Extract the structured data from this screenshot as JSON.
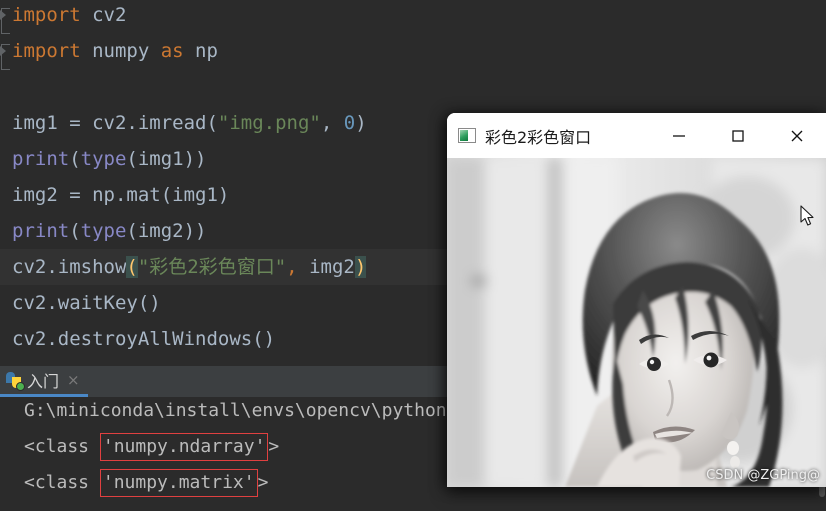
{
  "editor": {
    "lines": [
      {
        "id": "l1",
        "parts": [
          {
            "t": "import",
            "c": "kw"
          },
          {
            "t": " cv2",
            "c": "pl"
          }
        ],
        "fold": true,
        "current": false
      },
      {
        "id": "l2",
        "parts": [
          {
            "t": "import",
            "c": "kw"
          },
          {
            "t": " numpy ",
            "c": "pl"
          },
          {
            "t": "as",
            "c": "kw"
          },
          {
            "t": " np",
            "c": "pl"
          }
        ],
        "fold": true,
        "current": false
      },
      {
        "id": "l3",
        "parts": [],
        "fold": false,
        "current": false
      },
      {
        "id": "l4",
        "parts": [
          {
            "t": "img1 = cv2.imread(",
            "c": "pl"
          },
          {
            "t": "\"img.png\"",
            "c": "str"
          },
          {
            "t": ", ",
            "c": "pl"
          },
          {
            "t": "0",
            "c": "num"
          },
          {
            "t": ")",
            "c": "pl"
          }
        ],
        "fold": false,
        "current": false
      },
      {
        "id": "l5",
        "parts": [
          {
            "t": "print",
            "c": "bi"
          },
          {
            "t": "(",
            "c": "pl"
          },
          {
            "t": "type",
            "c": "bi"
          },
          {
            "t": "(img1))",
            "c": "pl"
          }
        ],
        "fold": false,
        "current": false
      },
      {
        "id": "l6",
        "parts": [
          {
            "t": "img2 = np.mat(img1)",
            "c": "pl"
          }
        ],
        "fold": false,
        "current": false
      },
      {
        "id": "l7",
        "parts": [
          {
            "t": "print",
            "c": "bi"
          },
          {
            "t": "(",
            "c": "pl"
          },
          {
            "t": "type",
            "c": "bi"
          },
          {
            "t": "(img2))",
            "c": "pl"
          }
        ],
        "fold": false,
        "current": false
      },
      {
        "id": "l8",
        "parts": [
          {
            "t": "cv2.imshow",
            "c": "pl"
          },
          {
            "t": "(",
            "c": "brace-hl"
          },
          {
            "t": "\"彩色2彩色窗口\"",
            "c": "str"
          },
          {
            "t": ",",
            "c": "kw"
          },
          {
            "t": " img2",
            "c": "pl"
          },
          {
            "t": ")",
            "c": "brace-hl"
          }
        ],
        "fold": false,
        "current": true
      },
      {
        "id": "l9",
        "parts": [
          {
            "t": "cv2.waitKey()",
            "c": "pl"
          }
        ],
        "fold": false,
        "current": false
      },
      {
        "id": "l10",
        "parts": [
          {
            "t": "cv2.destroyAllWindows()",
            "c": "pl"
          }
        ],
        "fold": false,
        "current": false
      }
    ]
  },
  "console": {
    "tab": {
      "label": "入门",
      "close_label": "×",
      "icon": "python-icon"
    },
    "lines": [
      {
        "id": "c1",
        "segments": [
          {
            "t": "G:\\miniconda\\install\\envs\\opencv\\python.exe",
            "box": false
          }
        ]
      },
      {
        "id": "c2",
        "segments": [
          {
            "t": "<class ",
            "box": false
          },
          {
            "t": "'numpy.ndarray'",
            "box": true
          },
          {
            "t": ">",
            "box": false
          }
        ]
      },
      {
        "id": "c3",
        "segments": [
          {
            "t": "<class ",
            "box": false
          },
          {
            "t": "'numpy.matrix'",
            "box": true
          },
          {
            "t": ">",
            "box": false
          }
        ]
      }
    ],
    "highlight_color": "#e04040"
  },
  "popup": {
    "title": "彩色2彩色窗口",
    "icon": "opencv-window-icon",
    "buttons": {
      "minimize": "minimize-button",
      "maximize": "maximize-button",
      "close": "close-button"
    },
    "image_alt": "grayscale-portrait-photo",
    "watermark": "CSDN @ZGPing@"
  },
  "colors": {
    "editor_bg": "#2b2b2b",
    "panel_bg": "#3c3f41",
    "keyword": "#cc7832",
    "string": "#6a8759",
    "number": "#6897bb",
    "builtin": "#8888c6",
    "text": "#a9b7c6",
    "brace_highlight_bg": "#3b514d",
    "brace_highlight_fg": "#ffc66d",
    "tab_underline": "#4a88c7"
  }
}
